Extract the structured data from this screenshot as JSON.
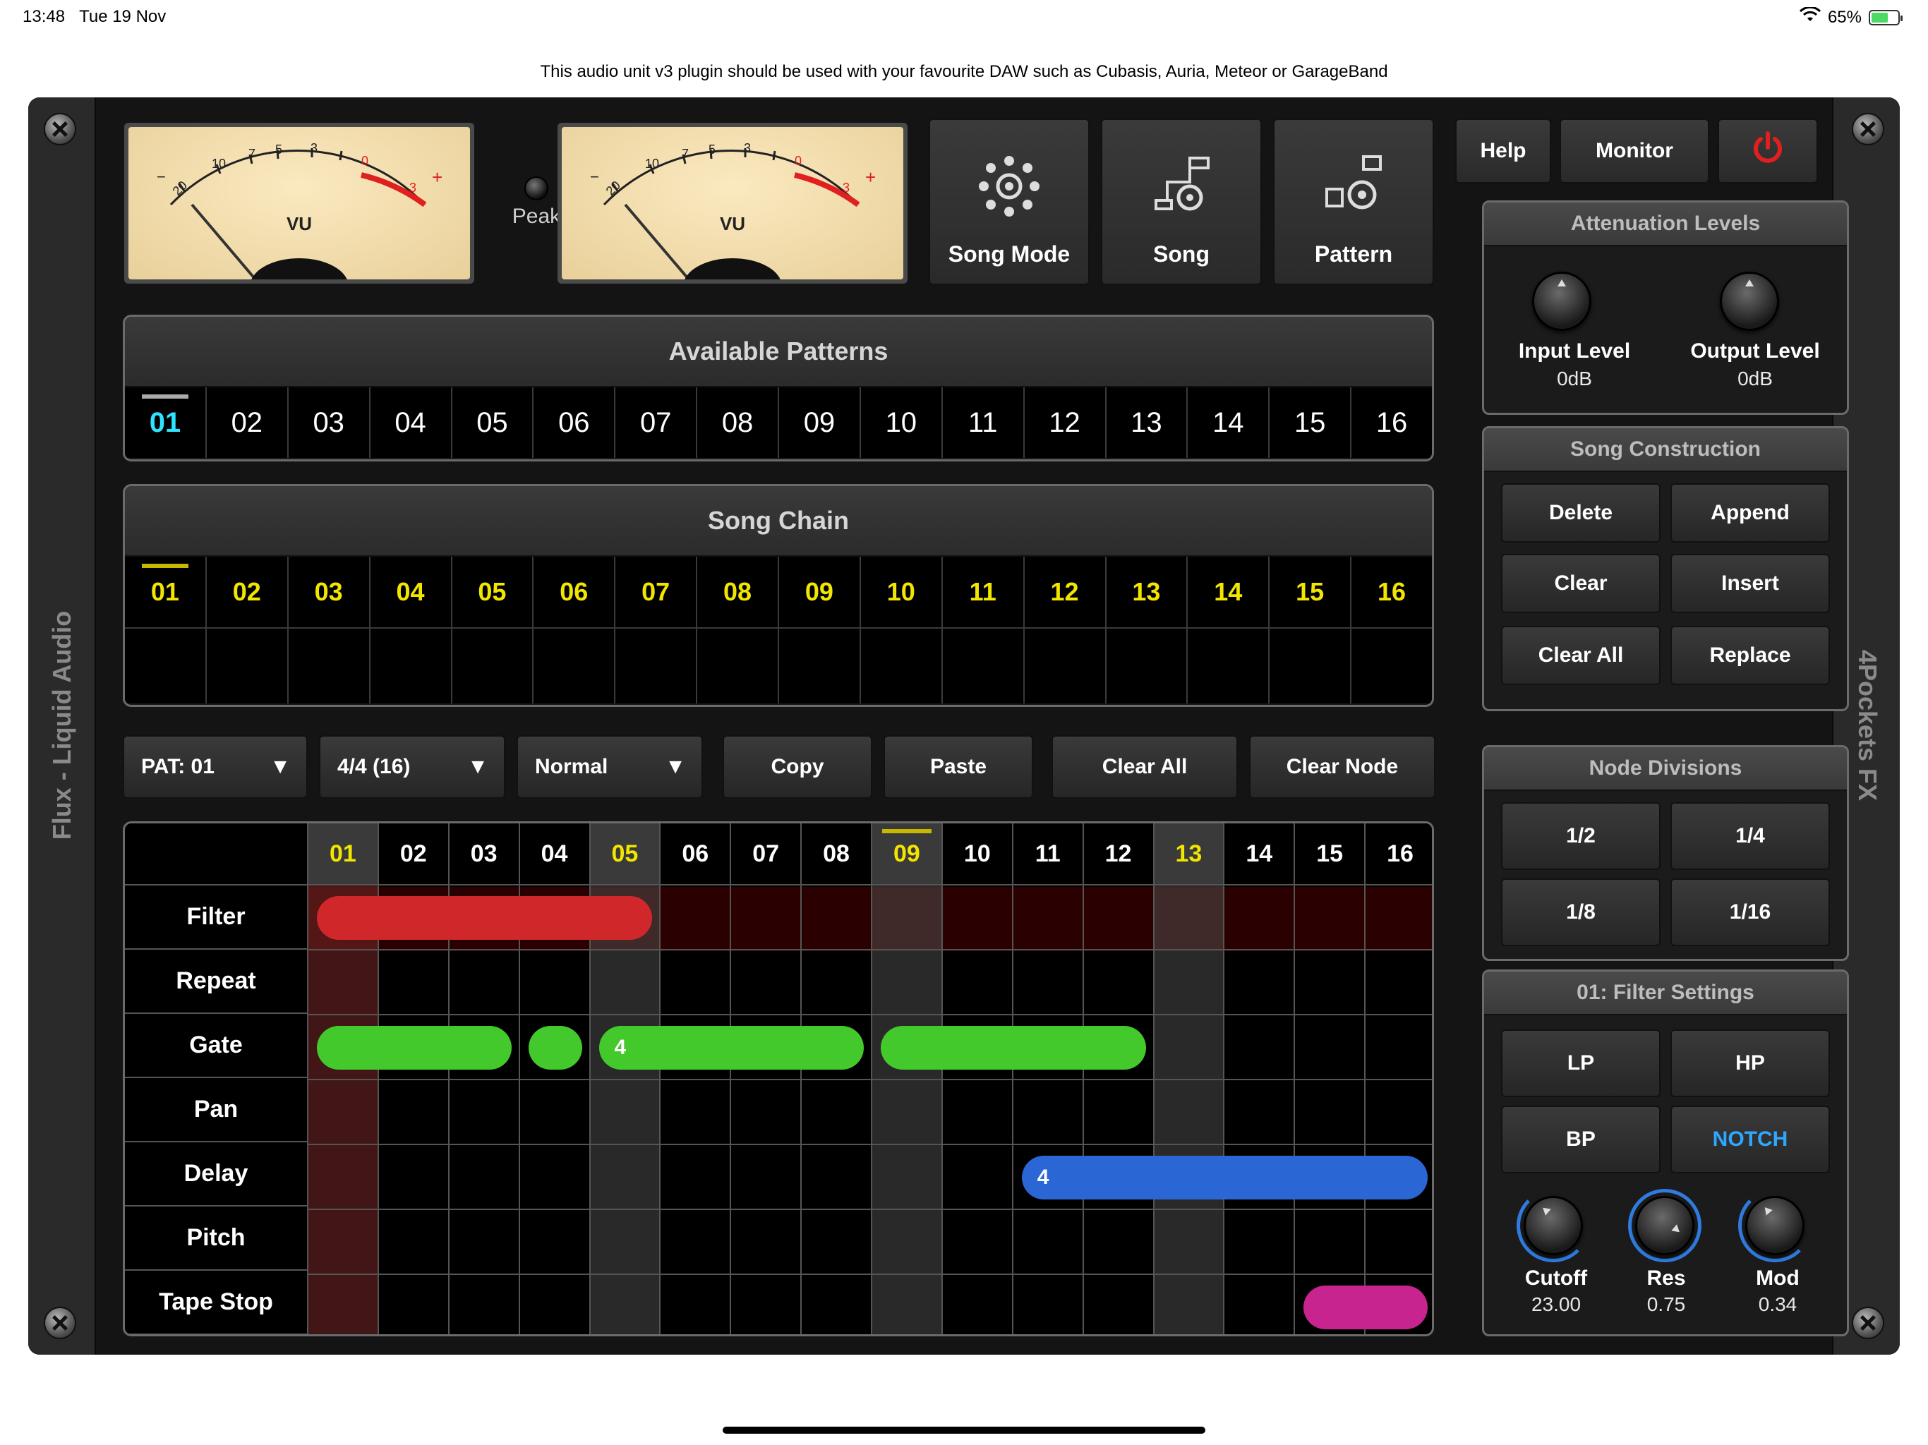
{
  "status": {
    "time": "13:48",
    "date": "Tue 19 Nov",
    "battery": "65%"
  },
  "hint": "This audio unit v3 plugin should be used with your favourite DAW such as Cubasis, Auria, Meteor or GarageBand",
  "rails": {
    "left": "Flux - Liquid Audio",
    "right": "4Pockets FX"
  },
  "meters": {
    "label": "VU",
    "peak": "Peak",
    "scale": [
      "20",
      "10",
      "7",
      "5",
      "3",
      "0",
      "3"
    ]
  },
  "top_buttons": {
    "song_mode": "Song Mode",
    "song": "Song",
    "pattern": "Pattern",
    "help": "Help",
    "monitor": "Monitor"
  },
  "available_patterns": {
    "title": "Available Patterns",
    "items": [
      "01",
      "02",
      "03",
      "04",
      "05",
      "06",
      "07",
      "08",
      "09",
      "10",
      "11",
      "12",
      "13",
      "14",
      "15",
      "16"
    ],
    "selected": "01"
  },
  "song_chain": {
    "title": "Song Chain",
    "items": [
      "01",
      "02",
      "03",
      "04",
      "05",
      "06",
      "07",
      "08",
      "09",
      "10",
      "11",
      "12",
      "13",
      "14",
      "15",
      "16"
    ],
    "selected": "01"
  },
  "toolbar": {
    "pattern_select": "PAT: 01",
    "time_sig": "4/4 (16)",
    "mode": "Normal",
    "copy": "Copy",
    "paste": "Paste",
    "clear_all": "Clear All",
    "clear_node": "Clear Node"
  },
  "grid": {
    "columns": [
      "01",
      "02",
      "03",
      "04",
      "05",
      "06",
      "07",
      "08",
      "09",
      "10",
      "11",
      "12",
      "13",
      "14",
      "15",
      "16"
    ],
    "highlight_columns": [
      "01",
      "05",
      "09",
      "13"
    ],
    "playhead": "09",
    "rows": [
      "Filter",
      "Repeat",
      "Gate",
      "Pan",
      "Delay",
      "Pitch",
      "Tape Stop"
    ],
    "nodes": [
      {
        "row": "Filter",
        "start": 1,
        "end": 5,
        "label": "",
        "color": "#d0282a"
      },
      {
        "row": "Gate",
        "start": 1,
        "end": 3,
        "label": "",
        "color": "#44c92c"
      },
      {
        "row": "Gate",
        "start": 4,
        "end": 4,
        "label": "",
        "color": "#44c92c"
      },
      {
        "row": "Gate",
        "start": 5,
        "end": 8,
        "label": "4",
        "color": "#44c92c"
      },
      {
        "row": "Gate",
        "start": 9,
        "end": 12,
        "label": "",
        "color": "#44c92c"
      },
      {
        "row": "Delay",
        "start": 11,
        "end": 16,
        "label": "4",
        "color": "#2a66d4"
      },
      {
        "row": "Tape Stop",
        "start": 15,
        "end": 16,
        "label": "",
        "color": "#c8248f"
      }
    ]
  },
  "attenuation": {
    "title": "Attenuation Levels",
    "input_label": "Input Level",
    "input_value": "0dB",
    "output_label": "Output Level",
    "output_value": "0dB"
  },
  "song_construction": {
    "title": "Song Construction",
    "buttons": [
      "Delete",
      "Append",
      "Clear",
      "Insert",
      "Clear All",
      "Replace"
    ]
  },
  "node_divisions": {
    "title": "Node Divisions",
    "buttons": [
      "1/2",
      "1/4",
      "1/8",
      "1/16"
    ]
  },
  "filter_settings": {
    "title": "01: Filter Settings",
    "types": [
      "LP",
      "HP",
      "BP",
      "NOTCH"
    ],
    "selected": "NOTCH",
    "cutoff_label": "Cutoff",
    "cutoff_value": "23.00",
    "res_label": "Res",
    "res_value": "0.75",
    "mod_label": "Mod",
    "mod_value": "0.34"
  },
  "colors": {
    "accent_cyan": "#2ee3ff",
    "chain_yellow": "#f2e600",
    "power_red": "#e02020",
    "knob_blue": "#2f7be0"
  }
}
